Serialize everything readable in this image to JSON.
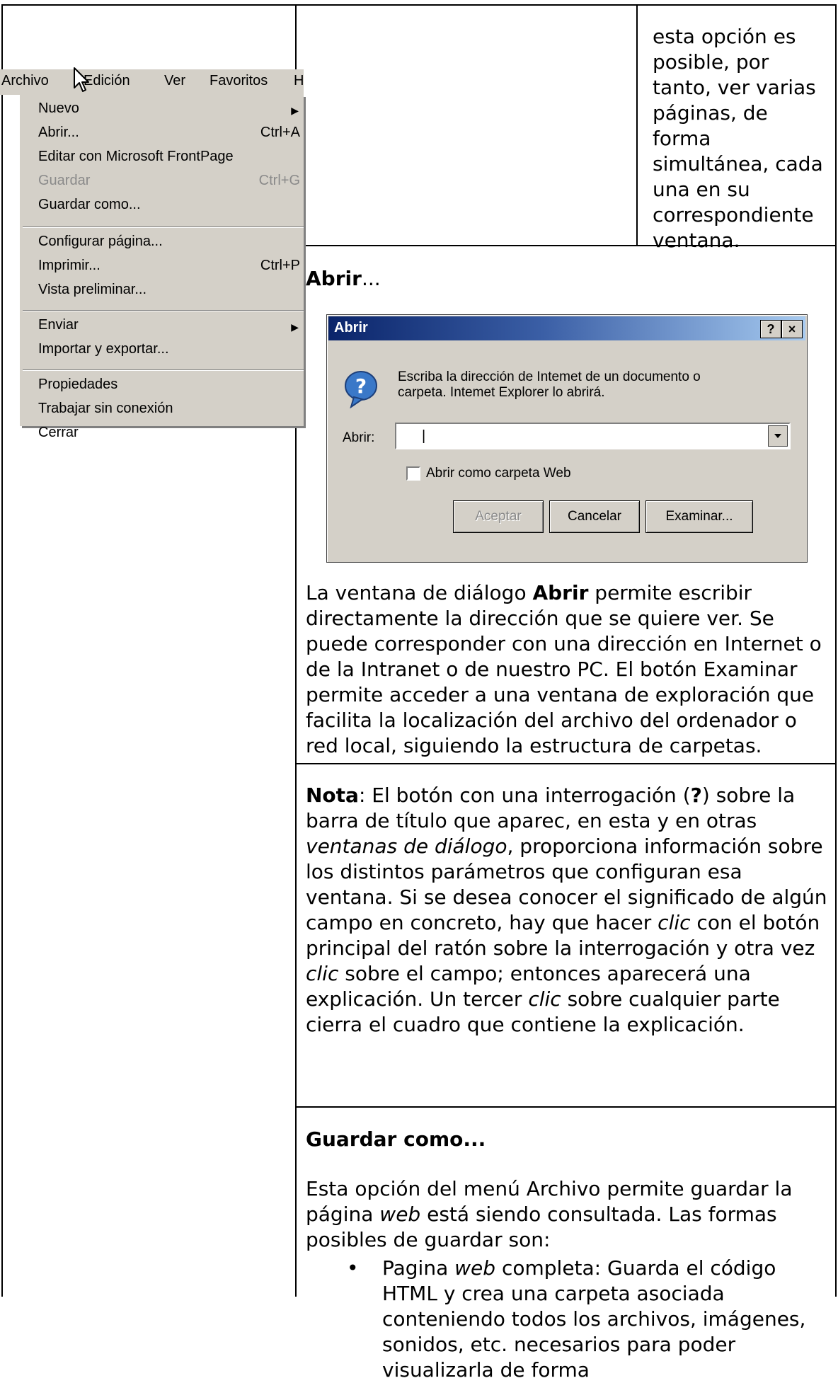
{
  "menu": {
    "bar": [
      "Archivo",
      "Edición",
      "Ver",
      "Favoritos",
      "H"
    ],
    "items": [
      {
        "label": "Nuevo",
        "shortcut": "",
        "submenu": true,
        "disabled": false
      },
      {
        "label": "Abrir...",
        "shortcut": "Ctrl+A",
        "submenu": false,
        "disabled": false
      },
      {
        "label": "Editar con Microsoft FrontPage",
        "shortcut": "",
        "submenu": false,
        "disabled": false
      },
      {
        "label": "Guardar",
        "shortcut": "Ctrl+G",
        "submenu": false,
        "disabled": true
      },
      {
        "label": "Guardar como...",
        "shortcut": "",
        "submenu": false,
        "disabled": false
      },
      {
        "label": "Configurar página...",
        "shortcut": "",
        "submenu": false,
        "disabled": false
      },
      {
        "label": "Imprimir...",
        "shortcut": "Ctrl+P",
        "submenu": false,
        "disabled": false
      },
      {
        "label": "Vista preliminar...",
        "shortcut": "",
        "submenu": false,
        "disabled": false
      },
      {
        "label": "Enviar",
        "shortcut": "",
        "submenu": true,
        "disabled": false
      },
      {
        "label": "Importar y exportar...",
        "shortcut": "",
        "submenu": false,
        "disabled": false
      },
      {
        "label": "Propiedades",
        "shortcut": "",
        "submenu": false,
        "disabled": false
      },
      {
        "label": "Trabajar sin conexión",
        "shortcut": "",
        "submenu": false,
        "disabled": false
      },
      {
        "label": "Cerrar",
        "shortcut": "",
        "submenu": false,
        "disabled": false
      }
    ]
  },
  "top_note": [
    "esta opción es",
    "posible, por",
    "tanto, ver varias",
    "páginas, de",
    "forma",
    "simultánea, cada",
    "una en su",
    "correspondiente",
    "ventana."
  ],
  "abrir_heading": {
    "bold": "Abrir",
    "rest": "..."
  },
  "dialog": {
    "title": "Abrir",
    "help_btn": "?",
    "close_btn": "×",
    "message_line1": "Escriba la dirección de Intemet de un documento o",
    "message_line2": "carpeta. Intemet Explorer lo abrirá.",
    "field_label": "Abrir:",
    "field_value": "|",
    "checkbox_label": "Abrir como carpeta Web",
    "accept": "Aceptar",
    "cancel": "Cancelar",
    "browse": "Examinar..."
  },
  "para_abrir": [
    {
      "t": "La ventana de diálogo "
    },
    {
      "b": "Abrir"
    },
    {
      "t": " permite escribir directamente la dirección que se quiere ver. Se puede corresponder con una dirección en Internet o de la Intranet o de nuestro PC. El botón Examinar permite acceder a una ventana de exploración que facilita la localización del archivo del ordenador o red local, siguiendo la estructura de carpetas."
    }
  ],
  "nota": [
    {
      "b": "Nota"
    },
    {
      "t": ": El botón con una interrogación ("
    },
    {
      "b": "?"
    },
    {
      "t": ") sobre la barra de título que aparec, en esta y en otras "
    },
    {
      "i": "ventanas de diálogo"
    },
    {
      "t": ", proporciona información sobre los distintos parámetros que configuran esa ventana. Si se desea conocer el significado de algún campo en concreto, hay que hacer "
    },
    {
      "i": "clic"
    },
    {
      "t": " con el botón principal del ratón sobre la interrogación y otra vez "
    },
    {
      "i": "clic"
    },
    {
      "t": " sobre el campo; entonces aparecerá una explicación. Un tercer "
    },
    {
      "i": "clic"
    },
    {
      "t": " sobre cualquier parte cierra el cuadro que contiene la explicación."
    }
  ],
  "guardar_heading": "Guardar como...",
  "guardar_intro": [
    {
      "t": "Esta opción del menú Archivo permite guardar la página "
    },
    {
      "i": "web"
    },
    {
      "t": " está siendo consultada. Las formas posibles de guardar son:"
    }
  ],
  "guardar_bullet": [
    {
      "t": "Pagina "
    },
    {
      "i": "web"
    },
    {
      "t": " completa: Guarda el código HTML y crea una carpeta asociada conteniendo todos los archivos, imágenes, sonidos, etc. necesarios para poder visualizarla de forma"
    }
  ]
}
